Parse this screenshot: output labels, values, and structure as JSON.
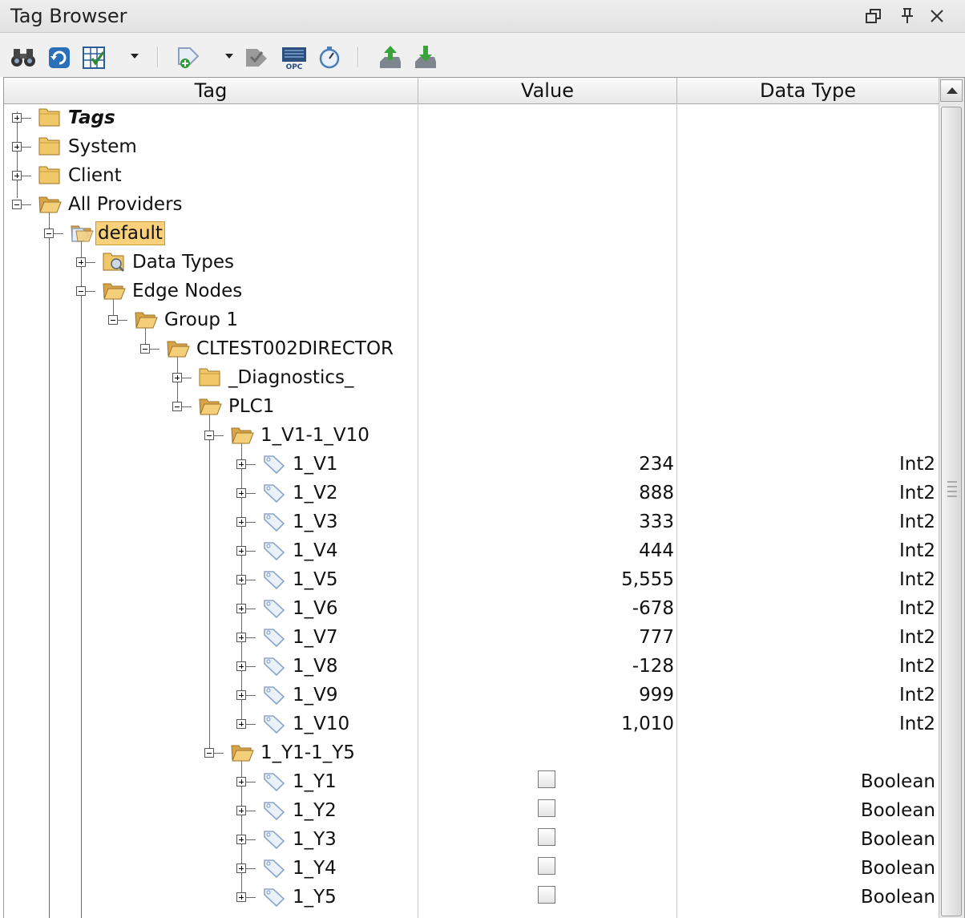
{
  "window": {
    "title": "Tag Browser",
    "controls": [
      "restore-icon",
      "pin-icon",
      "close-icon"
    ]
  },
  "toolbar": {
    "buttons": [
      "binoculars-icon",
      "refresh-icon",
      "table-edit-icon",
      "dropdown-arrow",
      "add-tag-icon",
      "dropdown-arrow",
      "tag-check-icon",
      "opc-icon",
      "timer-icon",
      "export-icon",
      "import-icon"
    ],
    "opc_text": "OPC"
  },
  "columns": {
    "tag": "Tag",
    "value": "Value",
    "datatype": "Data Type"
  },
  "tree": [
    {
      "label": "Tags",
      "level": 0,
      "expander": "plus",
      "icon": "folder-icon",
      "style": "bold"
    },
    {
      "label": "System",
      "level": 0,
      "expander": "plus",
      "icon": "folder-icon"
    },
    {
      "label": "Client",
      "level": 0,
      "expander": "plus",
      "icon": "folder-icon"
    },
    {
      "label": "All Providers",
      "level": 0,
      "expander": "minus",
      "icon": "folder-open-icon"
    },
    {
      "label": "default",
      "level": 1,
      "expander": "minus",
      "icon": "provider-folder-icon",
      "style": "selected"
    },
    {
      "label": "Data Types",
      "level": 2,
      "expander": "plus",
      "icon": "udt-folder-icon"
    },
    {
      "label": "Edge Nodes",
      "level": 2,
      "expander": "minus",
      "icon": "folder-open-icon"
    },
    {
      "label": "Group 1",
      "level": 3,
      "expander": "minus",
      "icon": "folder-open-icon"
    },
    {
      "label": "CLTEST002DIRECTOR",
      "level": 4,
      "expander": "minus",
      "icon": "folder-open-icon"
    },
    {
      "label": "_Diagnostics_",
      "level": 5,
      "expander": "plus",
      "icon": "folder-icon"
    },
    {
      "label": "PLC1",
      "level": 5,
      "expander": "minus",
      "icon": "folder-open-icon"
    },
    {
      "label": "1_V1-1_V10",
      "level": 6,
      "expander": "minus",
      "icon": "folder-open-icon"
    },
    {
      "label": "1_V1",
      "level": 7,
      "expander": "plus",
      "icon": "tag-icon",
      "value": "234",
      "datatype": "Int2"
    },
    {
      "label": "1_V2",
      "level": 7,
      "expander": "plus",
      "icon": "tag-icon",
      "value": "888",
      "datatype": "Int2"
    },
    {
      "label": "1_V3",
      "level": 7,
      "expander": "plus",
      "icon": "tag-icon",
      "value": "333",
      "datatype": "Int2"
    },
    {
      "label": "1_V4",
      "level": 7,
      "expander": "plus",
      "icon": "tag-icon",
      "value": "444",
      "datatype": "Int2"
    },
    {
      "label": "1_V5",
      "level": 7,
      "expander": "plus",
      "icon": "tag-icon",
      "value": "5,555",
      "datatype": "Int2"
    },
    {
      "label": "1_V6",
      "level": 7,
      "expander": "plus",
      "icon": "tag-icon",
      "value": "-678",
      "datatype": "Int2"
    },
    {
      "label": "1_V7",
      "level": 7,
      "expander": "plus",
      "icon": "tag-icon",
      "value": "777",
      "datatype": "Int2"
    },
    {
      "label": "1_V8",
      "level": 7,
      "expander": "plus",
      "icon": "tag-icon",
      "value": "-128",
      "datatype": "Int2"
    },
    {
      "label": "1_V9",
      "level": 7,
      "expander": "plus",
      "icon": "tag-icon",
      "value": "999",
      "datatype": "Int2"
    },
    {
      "label": "1_V10",
      "level": 7,
      "expander": "plus",
      "icon": "tag-icon",
      "value": "1,010",
      "datatype": "Int2"
    },
    {
      "label": "1_Y1-1_Y5",
      "level": 6,
      "expander": "minus",
      "icon": "folder-open-icon"
    },
    {
      "label": "1_Y1",
      "level": 7,
      "expander": "plus",
      "icon": "tag-icon",
      "checkbox": false,
      "datatype": "Boolean"
    },
    {
      "label": "1_Y2",
      "level": 7,
      "expander": "plus",
      "icon": "tag-icon",
      "checkbox": false,
      "datatype": "Boolean"
    },
    {
      "label": "1_Y3",
      "level": 7,
      "expander": "plus",
      "icon": "tag-icon",
      "checkbox": false,
      "datatype": "Boolean"
    },
    {
      "label": "1_Y4",
      "level": 7,
      "expander": "plus",
      "icon": "tag-icon",
      "checkbox": false,
      "datatype": "Boolean"
    },
    {
      "label": "1_Y5",
      "level": 7,
      "expander": "plus",
      "icon": "tag-icon",
      "checkbox": false,
      "datatype": "Boolean"
    }
  ]
}
